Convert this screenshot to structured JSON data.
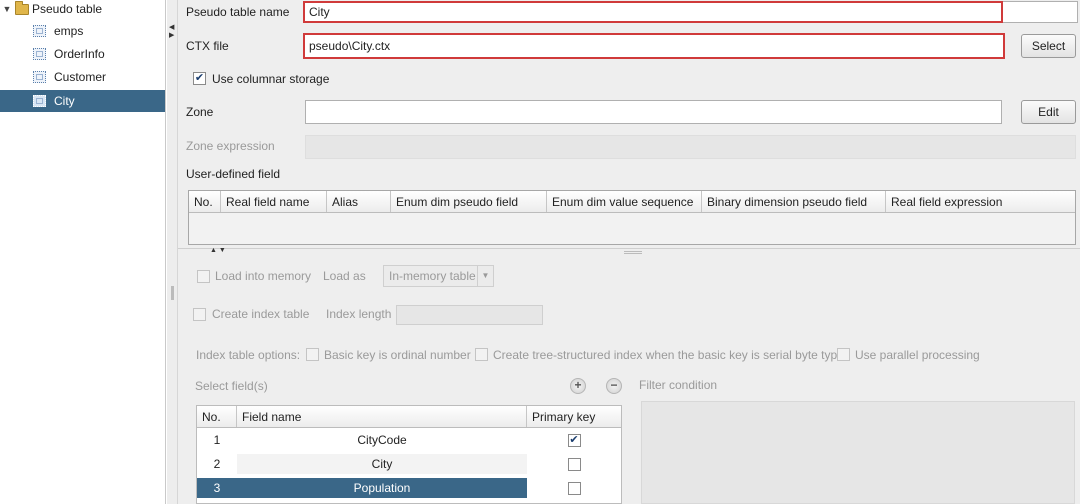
{
  "tree": {
    "root_label": "Pseudo table",
    "items": [
      {
        "label": "emps",
        "selected": false
      },
      {
        "label": "OrderInfo",
        "selected": false
      },
      {
        "label": "Customer",
        "selected": false
      },
      {
        "label": "City",
        "selected": true
      }
    ]
  },
  "form": {
    "pseudo_table_name_label": "Pseudo table name",
    "pseudo_table_name_value": "City",
    "ctx_file_label": "CTX file",
    "ctx_file_value": "pseudo\\City.ctx",
    "select_button": "Select",
    "use_columnar_label": "Use columnar storage",
    "use_columnar_checked": true,
    "zone_label": "Zone",
    "zone_value": "",
    "edit_button": "Edit",
    "zone_expression_label": "Zone expression",
    "user_defined_field_label": "User-defined field"
  },
  "udf_table": {
    "columns": [
      "No.",
      "Real field name",
      "Alias",
      "Enum dim pseudo field",
      "Enum dim value sequence",
      "Binary dimension pseudo field",
      "Real field expression"
    ]
  },
  "options": {
    "load_into_memory_label": "Load into memory",
    "load_as_label": "Load as",
    "load_as_value": "In-memory table",
    "create_index_label": "Create index table",
    "index_length_label": "Index length",
    "index_options_label": "Index table options:",
    "basic_key_ordinal_label": "Basic key is ordinal number",
    "tree_index_label": "Create tree-structured index when the basic key is serial byte type",
    "parallel_label": "Use parallel processing"
  },
  "fields": {
    "select_fields_label": "Select field(s)",
    "add_symbol": "+",
    "remove_symbol": "−",
    "filter_condition_label": "Filter condition",
    "columns": [
      "No.",
      "Field name",
      "Primary key"
    ],
    "rows": [
      {
        "no": "1",
        "name": "CityCode",
        "primary_key": true
      },
      {
        "no": "2",
        "name": "City",
        "primary_key": false
      },
      {
        "no": "3",
        "name": "Population",
        "primary_key": false
      }
    ]
  },
  "icons": {
    "checkmark": "✔",
    "expand_triangle": "▼"
  }
}
